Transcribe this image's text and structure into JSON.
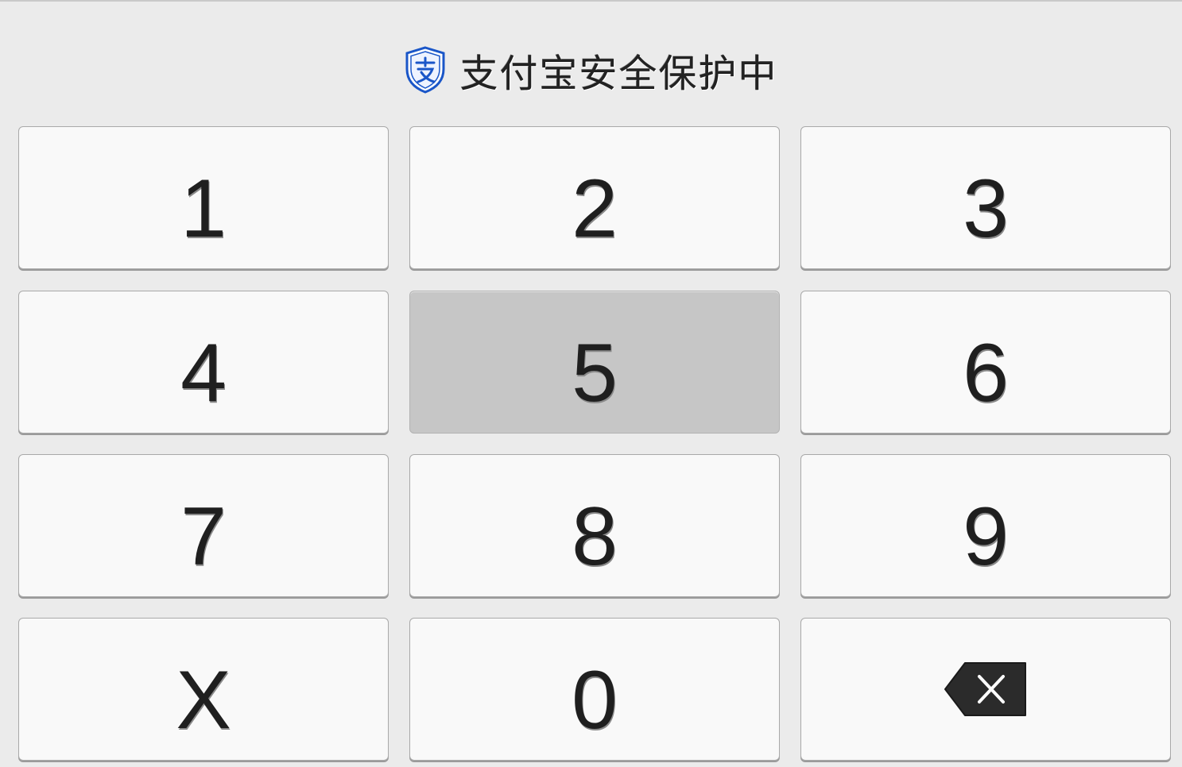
{
  "header": {
    "title": "支付宝安全保护中",
    "shield_icon": "alipay-shield-icon",
    "shield_color": "#1a56c8"
  },
  "top_strip": {
    "partial_text": ""
  },
  "keys": [
    {
      "label": "1"
    },
    {
      "label": "2"
    },
    {
      "label": "3"
    },
    {
      "label": "4"
    },
    {
      "label": "5",
      "pressed": true
    },
    {
      "label": "6"
    },
    {
      "label": "7"
    },
    {
      "label": "8"
    },
    {
      "label": "9"
    },
    {
      "label": "X"
    },
    {
      "label": "0"
    },
    {
      "label": "",
      "icon": "backspace-icon"
    }
  ],
  "colors": {
    "background": "#ebebeb",
    "key_background": "#f9f9f9",
    "key_pressed_background": "#c6c6c6",
    "key_text": "#1f1f1f",
    "backspace_icon": "#2b2b2b"
  }
}
